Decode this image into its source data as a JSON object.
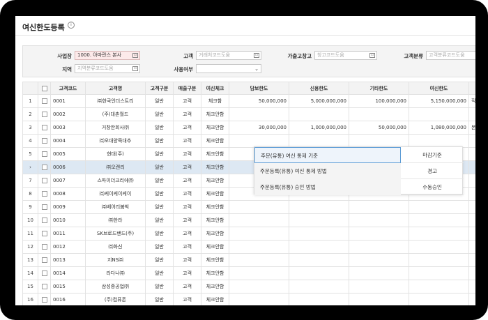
{
  "page": {
    "title": "여신한도등록",
    "title_icon": "info-icon"
  },
  "filter": {
    "business_label": "사업장",
    "business_value": "1000. 아마란스 본사",
    "customer_label": "고객",
    "customer_placeholder": "거래처코드도움",
    "warehouse_label": "가출고창고",
    "warehouse_placeholder": "창고코드도움",
    "custclass_label": "고객분류",
    "custclass_placeholder": "고객분류코드도움",
    "region_label": "지역",
    "region_placeholder": "지역분류코드도움",
    "usage_label": "사용여부",
    "usage_value": ""
  },
  "grid": {
    "headers": [
      "",
      "",
      "고객코드",
      "고객명",
      "고객구분",
      "매출구분",
      "여신체크",
      "담보한도",
      "신용한도",
      "기타한도",
      "여신한도",
      ""
    ],
    "rows": [
      {
        "no": "1",
        "code": "0001",
        "name": "㈜한국인더스트리",
        "cls": "일반",
        "sales": "고객",
        "check": "체크함",
        "collateral": "50,000,000",
        "credit": "5,000,000,000",
        "other": "100,000,000",
        "limit": "5,150,000,000",
        "extra": "직영"
      },
      {
        "no": "2",
        "code": "0002",
        "name": "(주)대촌월드",
        "cls": "일반",
        "sales": "고객",
        "check": "체크안함",
        "collateral": "",
        "credit": "",
        "other": "",
        "limit": "",
        "extra": ""
      },
      {
        "no": "3",
        "code": "0003",
        "name": "거창한회사㈜",
        "cls": "일반",
        "sales": "고객",
        "check": "체크안함",
        "collateral": "30,000,000",
        "credit": "1,000,000,000",
        "other": "50,000,000",
        "limit": "1,080,000,000",
        "extra": "본사"
      },
      {
        "no": "4",
        "code": "0004",
        "name": "㈜오대양뮥대추",
        "cls": "일반",
        "sales": "고객",
        "check": "체크안함",
        "collateral": "",
        "credit": "",
        "other": "",
        "limit": "",
        "extra": ""
      },
      {
        "no": "5",
        "code": "0005",
        "name": "현대(주)",
        "cls": "일반",
        "sales": "고객",
        "check": "체크안함",
        "collateral": "",
        "credit": "",
        "other": "",
        "limit": "",
        "extra": ""
      },
      {
        "no": "›",
        "code": "0006",
        "name": "㈜오렌리",
        "cls": "일반",
        "sales": "고객",
        "check": "체크안함",
        "collateral": "",
        "credit": "",
        "other": "",
        "limit": "",
        "extra": ""
      },
      {
        "no": "7",
        "code": "0007",
        "name": "스파이더크리에㈜",
        "cls": "일반",
        "sales": "고객",
        "check": "체크안함",
        "collateral": "",
        "credit": "",
        "other": "",
        "limit": "",
        "extra": ""
      },
      {
        "no": "8",
        "code": "0008",
        "name": "㈜케이케이케이",
        "cls": "일반",
        "sales": "고객",
        "check": "체크안함",
        "collateral": "",
        "credit": "",
        "other": "",
        "limit": "",
        "extra": ""
      },
      {
        "no": "9",
        "code": "0009",
        "name": "㈜베어리봄빅",
        "cls": "일반",
        "sales": "고객",
        "check": "체크안함",
        "collateral": "",
        "credit": "",
        "other": "",
        "limit": "",
        "extra": ""
      },
      {
        "no": "10",
        "code": "0010",
        "name": "㈜한라",
        "cls": "일반",
        "sales": "고객",
        "check": "체크안함",
        "collateral": "",
        "credit": "",
        "other": "",
        "limit": "",
        "extra": ""
      },
      {
        "no": "11",
        "code": "0011",
        "name": "SK브로드밴드(주)",
        "cls": "일반",
        "sales": "고객",
        "check": "체크안함",
        "collateral": "",
        "credit": "",
        "other": "",
        "limit": "",
        "extra": ""
      },
      {
        "no": "12",
        "code": "0012",
        "name": "㈜화신",
        "cls": "일반",
        "sales": "고객",
        "check": "체크안함",
        "collateral": "",
        "credit": "",
        "other": "",
        "limit": "",
        "extra": ""
      },
      {
        "no": "13",
        "code": "0013",
        "name": "지NS㈜",
        "cls": "일반",
        "sales": "고객",
        "check": "체크안함",
        "collateral": "",
        "credit": "",
        "other": "",
        "limit": "",
        "extra": ""
      },
      {
        "no": "14",
        "code": "0014",
        "name": "라다나㈜",
        "cls": "일반",
        "sales": "고객",
        "check": "체크안함",
        "collateral": "",
        "credit": "",
        "other": "",
        "limit": "",
        "extra": ""
      },
      {
        "no": "15",
        "code": "0015",
        "name": "삼성중공업㈜",
        "cls": "일반",
        "sales": "고객",
        "check": "체크안함",
        "collateral": "",
        "credit": "",
        "other": "",
        "limit": "",
        "extra": ""
      },
      {
        "no": "16",
        "code": "0016",
        "name": "(주)컴퓨존",
        "cls": "일반",
        "sales": "고객",
        "check": "체크안함",
        "collateral": "",
        "credit": "",
        "other": "",
        "limit": "",
        "extra": ""
      }
    ]
  },
  "popup": {
    "rows": [
      {
        "label": "주문(유통) 여신 통제 기준",
        "value": "마감기준"
      },
      {
        "label": "주문등록(유통) 여신 통제 방법",
        "value": "경고"
      },
      {
        "label": "주문등록(유통) 승인 방법",
        "value": "수동승인"
      }
    ]
  },
  "colors": {
    "selected_row": "#dde8f3",
    "popup_active_border": "#5b9bd5",
    "required_field": "#fdeaea"
  }
}
